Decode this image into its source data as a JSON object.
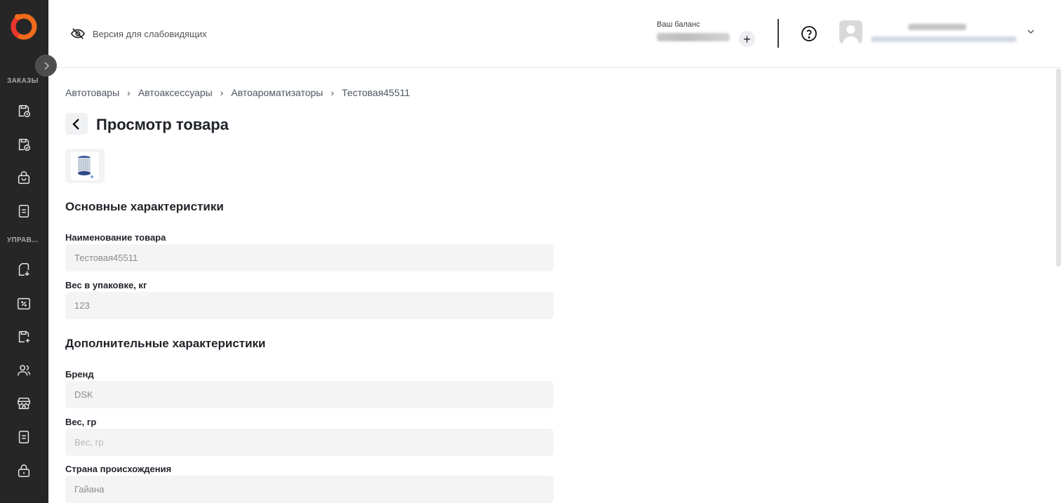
{
  "sidebar": {
    "sections": [
      {
        "label": "ЗАКАЗЫ"
      },
      {
        "label": "УПРАВ..."
      }
    ],
    "icons": [
      "order-clock-icon",
      "order-check-icon",
      "shopping-bag-icon",
      "document-icon",
      "return-document-icon",
      "discount-icon",
      "add-product-icon",
      "users-icon",
      "store-icon",
      "report-document-icon",
      "lock-icon"
    ]
  },
  "header": {
    "accessibility_label": "Версия для слабовидящих",
    "balance_label": "Ваш баланс",
    "add_balance_label": "+"
  },
  "breadcrumb": [
    "Автотовары",
    "Автоаксессуары",
    "Автоароматизаторы",
    "Тестовая45511"
  ],
  "page": {
    "title": "Просмотр товара"
  },
  "sections": {
    "main": {
      "title": "Основные характеристики",
      "fields": [
        {
          "label": "Наименование товара",
          "value": "Тестовая45511"
        },
        {
          "label": "Вес в упаковке, кг",
          "value": "123"
        }
      ]
    },
    "additional": {
      "title": "Дополнительные характеристики",
      "fields": [
        {
          "label": "Бренд",
          "value": "DSK"
        },
        {
          "label": "Вес, гр",
          "placeholder": "Вес, гр"
        },
        {
          "label": "Страна происхождения",
          "value": "Гайана"
        }
      ]
    }
  },
  "colors": {
    "sidebar_bg": "#262626",
    "logo_orange": "#f26a1b",
    "logo_red": "#e8362f",
    "field_bg": "#f4f4f4"
  }
}
